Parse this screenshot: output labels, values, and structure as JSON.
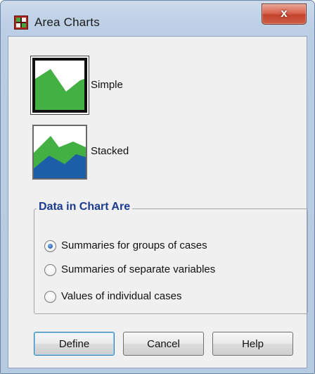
{
  "window": {
    "title": "Area Charts",
    "close_label": "x"
  },
  "chart_types": [
    {
      "label": "Simple",
      "selected": true,
      "icon": "simple-area-chart-icon"
    },
    {
      "label": "Stacked",
      "selected": false,
      "icon": "stacked-area-chart-icon"
    }
  ],
  "data_group": {
    "title": "Data in Chart Are",
    "options": [
      {
        "label": "Summaries for groups of cases",
        "selected": true
      },
      {
        "label": "Summaries of separate variables",
        "selected": false
      },
      {
        "label": "Values of individual cases",
        "selected": false
      }
    ]
  },
  "buttons": {
    "define": "Define",
    "cancel": "Cancel",
    "help": "Help"
  },
  "colors": {
    "group_title": "#1a3b8c",
    "area_green": "#43b043",
    "area_blue": "#1d5ea8",
    "close_red": "#c2432e"
  }
}
